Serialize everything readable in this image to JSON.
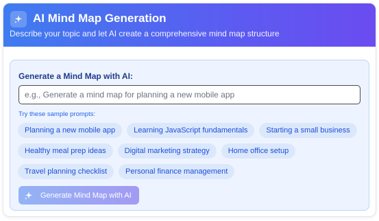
{
  "header": {
    "title": "AI Mind Map Generation",
    "subtitle": "Describe your topic and let AI create a comprehensive mind map structure",
    "icon": "sparkles-icon"
  },
  "form": {
    "label": "Generate a Mind Map with AI:",
    "input_value": "",
    "input_placeholder": "e.g., Generate a mind map for planning a new mobile app",
    "sample_label": "Try these sample prompts:",
    "sample_prompts": [
      [
        "Planning a new mobile app",
        "Learning JavaScript fundamentals",
        "Starting a small business"
      ],
      [
        "Healthy meal prep ideas",
        "Digital marketing strategy",
        "Home office setup"
      ],
      [
        "Travel planning checklist",
        "Personal finance management"
      ]
    ],
    "generate_label": "Generate Mind Map with AI",
    "generate_icon": "sparkles-icon"
  },
  "colors": {
    "header_gradient_start": "#3f7cf0",
    "header_gradient_end": "#6a4cf0",
    "chip_bg": "#dbe8fc",
    "chip_text": "#1d4ed8",
    "panel_bg": "#eef4ff"
  }
}
